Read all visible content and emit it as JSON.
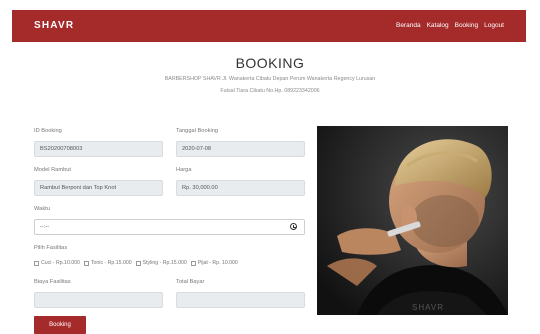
{
  "navbar": {
    "brand": "SHAVR",
    "links": [
      "Beranda",
      "Katalog",
      "Booking",
      "Logout"
    ]
  },
  "header": {
    "title": "BOOKING",
    "subtitle_line1": "BARBERSHOP SHAVR Jl. Wanakerta Cibatu Depan Perum Wanakerta Regency Lurusan",
    "subtitle_line2": "Futsal Tiara Cibatu No.Hp. 089223342006"
  },
  "form": {
    "id_booking": {
      "label": "ID Booking",
      "value": "BS20200708003"
    },
    "tanggal_booking": {
      "label": "Tanggal Booking",
      "value": "2020-07-08"
    },
    "model_rambut": {
      "label": "Model Rambut",
      "value": "Rambut Berponi dan Top Knot"
    },
    "harga": {
      "label": "Harga",
      "value": "Rp. 30,000.00"
    },
    "waktu": {
      "label": "Waktu",
      "value": "--:--"
    },
    "fasilitas": {
      "label": "Pilih Fasilitas",
      "options": [
        "Cuci - Rp.10.000",
        "Tonic - Rp.15.000",
        "Styling - Rp.15.000",
        "Pijat - Rp. 10.000"
      ]
    },
    "biaya_fasilitas": {
      "label": "Biaya Fasilitas",
      "value": ""
    },
    "total_bayar": {
      "label": "Total Bayar",
      "value": ""
    },
    "submit_label": "Booking"
  },
  "image": {
    "icon": "barber-photo"
  },
  "colors": {
    "primary": "#a52a2a",
    "field_bg": "#e9ecef"
  }
}
